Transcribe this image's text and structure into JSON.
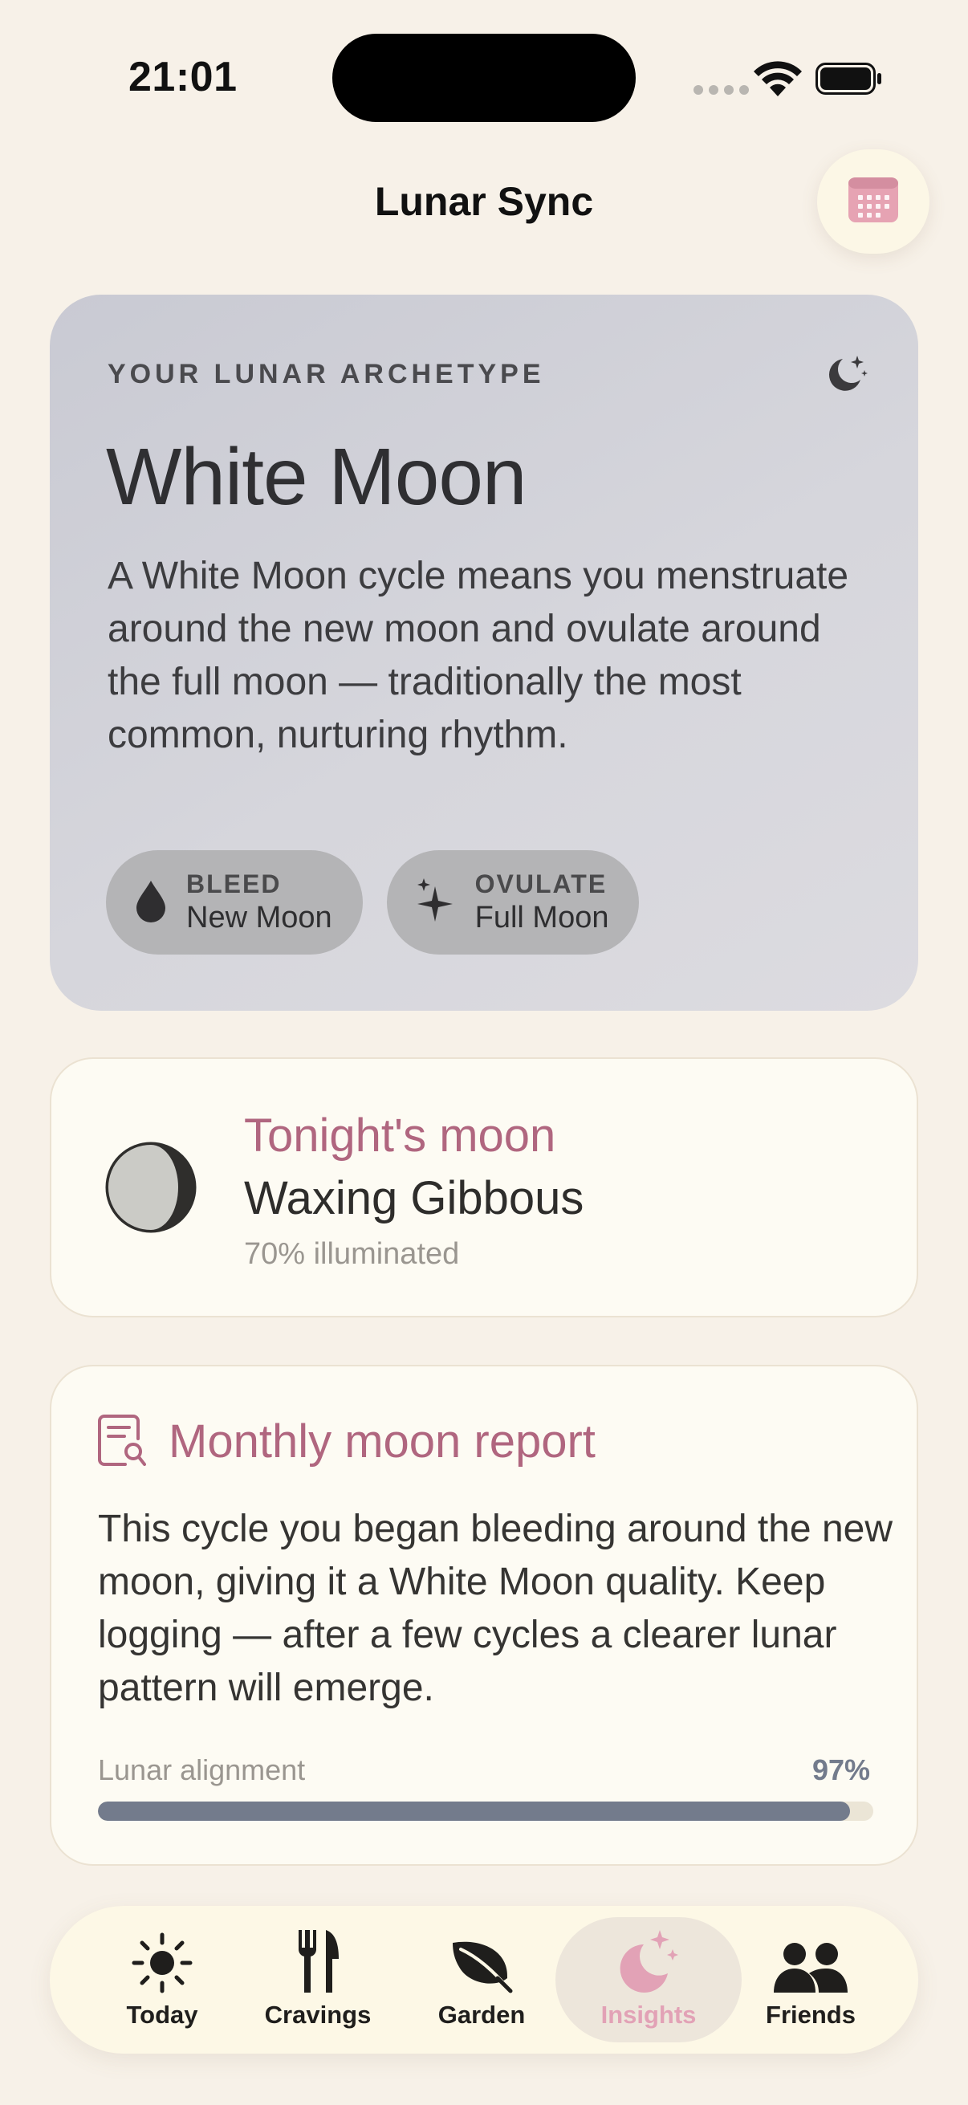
{
  "status_bar": {
    "time": "21:01"
  },
  "header": {
    "title": "Lunar Sync",
    "calendar_icon": "calendar-icon"
  },
  "archetype": {
    "eyebrow": "YOUR LUNAR ARCHETYPE",
    "title": "White Moon",
    "description": "A White Moon cycle means you menstruate around the new moon and ovulate around the full moon — traditionally the most common, nurturing rhythm.",
    "chips": [
      {
        "label": "BLEED",
        "value": "New Moon",
        "icon": "drop-icon"
      },
      {
        "label": "OVULATE",
        "value": "Full Moon",
        "icon": "sparkle-icon"
      }
    ]
  },
  "tonight": {
    "title": "Tonight's moon",
    "phase": "Waxing Gibbous",
    "illumination": "70% illuminated"
  },
  "report": {
    "title": "Monthly moon report",
    "body": "This cycle you began bleeding around the new moon, giving it a White Moon quality. Keep logging — after a few cycles a clearer lunar pattern will emerge.",
    "alignment_label": "Lunar alignment",
    "alignment_value": "97%",
    "alignment_fraction": 0.97
  },
  "tabs": [
    {
      "label": "Today",
      "icon": "sun-icon",
      "active": false
    },
    {
      "label": "Cravings",
      "icon": "fork-knife-icon",
      "active": false
    },
    {
      "label": "Garden",
      "icon": "leaf-icon",
      "active": false
    },
    {
      "label": "Insights",
      "icon": "moon-stars-icon",
      "active": true
    },
    {
      "label": "Friends",
      "icon": "people-icon",
      "active": false
    }
  ],
  "colors": {
    "background": "#f7f1e8",
    "accent_rose": "#b0667f",
    "active_tab": "#e2a2b6",
    "progress": "#737b8c"
  }
}
